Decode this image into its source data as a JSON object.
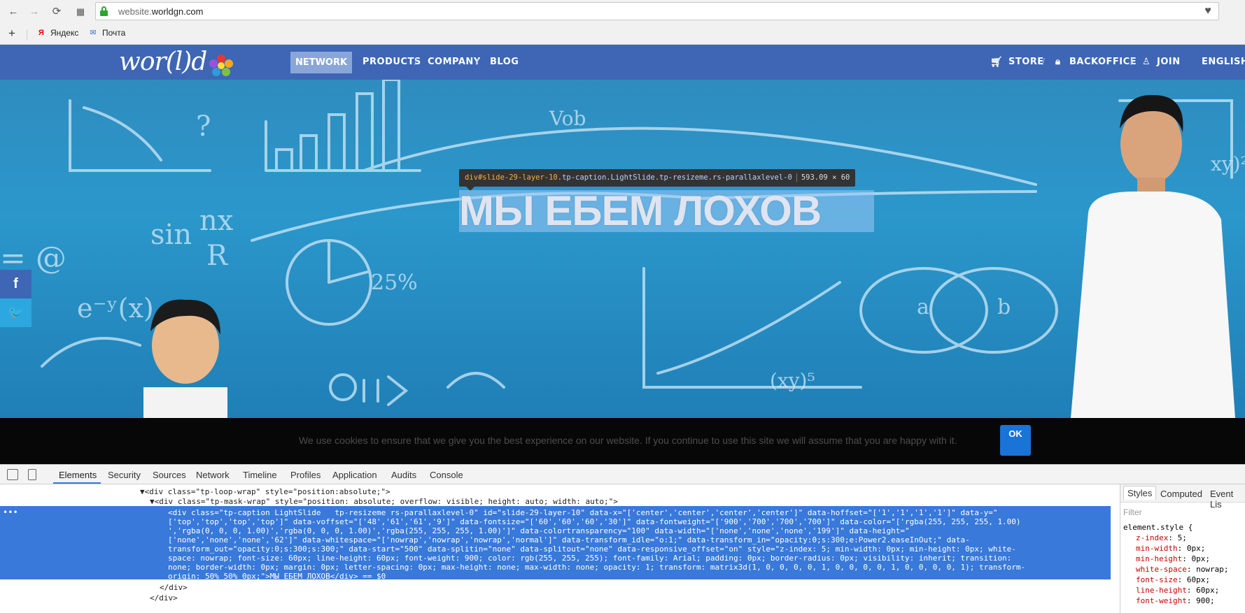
{
  "browser": {
    "url_prefix": "website.",
    "url_domain": "worldgn.com",
    "bookmarks": [
      {
        "label": "Яндекс",
        "icon": "yandex-icon",
        "letter": "Я"
      },
      {
        "label": "Почта",
        "icon": "mail-icon",
        "letter": "✉"
      }
    ]
  },
  "site": {
    "logo_text": "wor(l)d",
    "nav": {
      "active": "NETWORK",
      "items": [
        "PRODUCTS",
        "COMPANY",
        "BLOG"
      ],
      "right": [
        "STORE",
        "BACKOFFICE",
        "JOIN",
        "ENGLISH"
      ]
    },
    "hero_caption": "МЫ ЕБЕМ ЛОХОВ",
    "inspector_tooltip": {
      "tag": "div",
      "id": "#slide-29-layer-10",
      "classes": ".tp-caption.LightSlide.tp-resizeme.rs-parallaxlevel-0",
      "size": "593.09 × 60"
    },
    "social": [
      {
        "name": "facebook",
        "glyph": "f",
        "color": "#3b5998"
      },
      {
        "name": "twitter",
        "glyph": "🐦",
        "color": "#1da1f2"
      }
    ],
    "cookie": {
      "text": "We use cookies to ensure that we give you the best experience on our website. If you continue to use this site we will assume that you are happy with it.",
      "ok": "OK"
    }
  },
  "devtools": {
    "tabs": [
      "Elements",
      "Security",
      "Sources",
      "Network",
      "Timeline",
      "Profiles",
      "Application",
      "Audits",
      "Console"
    ],
    "code_lines": [
      "▼<div class=\"tp-loop-wrap\" style=\"position:absolute;\">",
      "▼<div class=\"tp-mask-wrap\" style=\"position: absolute; overflow: visible; height: auto; width: auto;\">"
    ],
    "selected_lines": [
      "<div class=\"tp-caption LightSlide   tp-resizeme rs-parallaxlevel-0\" id=\"slide-29-layer-10\" data-x=\"['center','center','center','center']\" data-hoffset=\"['1','1','1','1']\" data-y=\"",
      "['top','top','top','top']\" data-voffset=\"['48','61','61','9']\" data-fontsize=\"['60','60','60','30']\" data-fontweight=\"['900','700','700','700']\" data-color=\"['rgba(255, 255, 255, 1.00)",
      "','rgba(0, 0, 0, 1.00)','rgba(0, 0, 0, 1.00)','rgba(255, 255, 255, 1.00)']\" data-colortransparency=\"100\" data-width=\"['none','none','none','199']\" data-height=\"",
      "['none','none','none','62']\" data-whitespace=\"['nowrap','nowrap','nowrap','normal']\" data-transform_idle=\"o:1;\" data-transform_in=\"opacity:0;s:300;e:Power2.easeInOut;\" data-",
      "transform_out=\"opacity:0;s:300;s:300;\" data-start=\"500\" data-splitin=\"none\" data-splitout=\"none\" data-responsive_offset=\"on\" style=\"z-index: 5; min-width: 0px; min-height: 0px; white-",
      "space: nowrap; font-size: 60px; line-height: 60px; font-weight: 900; color: rgb(255, 255, 255); font-family: Arial; padding: 0px; border-radius: 0px; visibility: inherit; transition:",
      "none; border-width: 0px; margin: 0px; letter-spacing: 0px; max-height: none; max-width: none; opacity: 1; transform: matrix3d(1, 0, 0, 0, 0, 1, 0, 0, 0, 0, 1, 0, 0, 0, 0, 1); transform-",
      "origin: 50% 50% 0px;\">МЫ ЕБЕМ ЛОХОВ</div> == $0"
    ],
    "after_lines": [
      "</div>",
      "</div>"
    ],
    "styles_tabs": [
      "Styles",
      "Computed",
      "Event Lis"
    ],
    "filter_placeholder": "Filter",
    "element_style_header": "element.style {",
    "style_rules": [
      {
        "prop": "z-index",
        "val": "5;"
      },
      {
        "prop": "min-width",
        "val": "0px;"
      },
      {
        "prop": "min-height",
        "val": "0px;"
      },
      {
        "prop": "white-space",
        "val": "nowrap;"
      },
      {
        "prop": "font-size",
        "val": "60px;"
      },
      {
        "prop": "line-height",
        "val": "60px;"
      },
      {
        "prop": "font-weight",
        "val": "900;"
      }
    ]
  }
}
